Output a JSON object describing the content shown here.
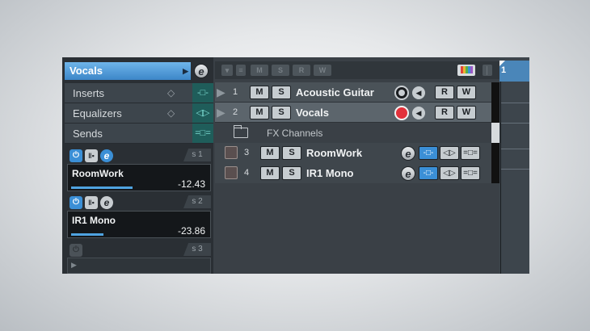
{
  "inspector": {
    "track_name": "Vocals",
    "rows": [
      {
        "label": "Inserts"
      },
      {
        "label": "Equalizers"
      },
      {
        "label": "Sends"
      }
    ],
    "sends": [
      {
        "slot": "s 1",
        "name": "RoomWork",
        "value": "-12.43",
        "level": 0.45
      },
      {
        "slot": "s 2",
        "name": "IR1 Mono",
        "value": "-23.86",
        "level": 0.24
      },
      {
        "slot": "s 3",
        "name": "",
        "value": "",
        "level": 0
      }
    ]
  },
  "toolbar": {
    "buttons": [
      "M",
      "S",
      "R",
      "W"
    ]
  },
  "tracks": [
    {
      "num": "1",
      "name": "Acoustic Guitar",
      "type": "audio",
      "record_enabled": false
    },
    {
      "num": "2",
      "name": "Vocals",
      "type": "audio",
      "record_enabled": true
    },
    {
      "num": "",
      "name": "FX Channels",
      "type": "folder"
    },
    {
      "num": "3",
      "name": "RoomWork",
      "type": "fx"
    },
    {
      "num": "4",
      "name": "IR1 Mono",
      "type": "fx"
    }
  ],
  "labels": {
    "mute": "M",
    "solo": "S",
    "read": "R",
    "write": "W",
    "edit": "e"
  },
  "ruler": {
    "position": "1"
  },
  "colors": {
    "accent": "#3b8fd6",
    "record": "#e2313b",
    "selection": "#5c656c"
  }
}
